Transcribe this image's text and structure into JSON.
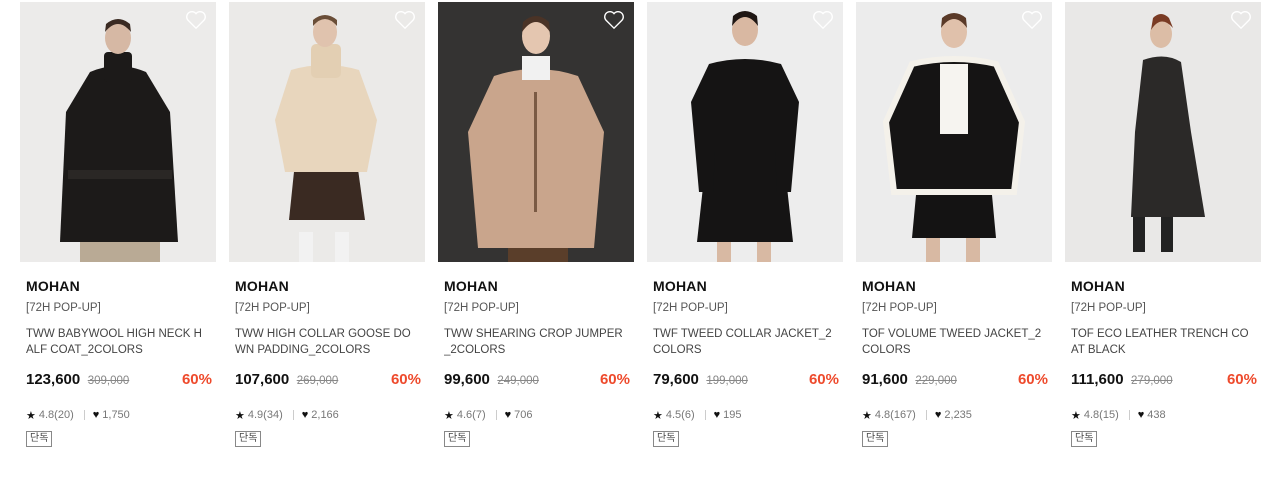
{
  "colors": {
    "discount": "#ee4a2c",
    "text": "#111111",
    "muted": "#888888"
  },
  "products": [
    {
      "brand": "MOHAN",
      "tag": "[72H POP-UP]",
      "name": "TWW BABYWOOL HIGH NECK HALF COAT_2COLORS",
      "price": "123,600",
      "original_price": "309,000",
      "discount": "60%",
      "rating": "4.8(20)",
      "likes": "1,750",
      "badge": "단독",
      "heart_icon": "heart-outline-icon",
      "photo_bg": "#ecebea"
    },
    {
      "brand": "MOHAN",
      "tag": "[72H POP-UP]",
      "name": "TWW HIGH COLLAR GOOSE DOWN PADDING_2COLORS",
      "price": "107,600",
      "original_price": "269,000",
      "discount": "60%",
      "rating": "4.9(34)",
      "likes": "2,166",
      "badge": "단독",
      "heart_icon": "heart-outline-icon",
      "photo_bg": "#ebeae8"
    },
    {
      "brand": "MOHAN",
      "tag": "[72H POP-UP]",
      "name": "TWW SHEARING CROP JUMPER_2COLORS",
      "price": "99,600",
      "original_price": "249,000",
      "discount": "60%",
      "rating": "4.6(7)",
      "likes": "706",
      "badge": "단독",
      "heart_icon": "heart-outline-icon",
      "photo_bg": "#343332"
    },
    {
      "brand": "MOHAN",
      "tag": "[72H POP-UP]",
      "name": "TWF TWEED COLLAR JACKET_2COLORS",
      "price": "79,600",
      "original_price": "199,000",
      "discount": "60%",
      "rating": "4.5(6)",
      "likes": "195",
      "badge": "단독",
      "heart_icon": "heart-outline-icon",
      "photo_bg": "#ededed"
    },
    {
      "brand": "MOHAN",
      "tag": "[72H POP-UP]",
      "name": "TOF VOLUME TWEED JACKET_2COLORS",
      "price": "91,600",
      "original_price": "229,000",
      "discount": "60%",
      "rating": "4.8(167)",
      "likes": "2,235",
      "badge": "단독",
      "heart_icon": "heart-outline-icon",
      "photo_bg": "#ececec"
    },
    {
      "brand": "MOHAN",
      "tag": "[72H POP-UP]",
      "name": "TOF ECO LEATHER TRENCH COAT BLACK",
      "price": "111,600",
      "original_price": "279,000",
      "discount": "60%",
      "rating": "4.8(15)",
      "likes": "438",
      "badge": "단독",
      "heart_icon": "heart-outline-icon",
      "photo_bg": "#e9e8e7"
    }
  ]
}
